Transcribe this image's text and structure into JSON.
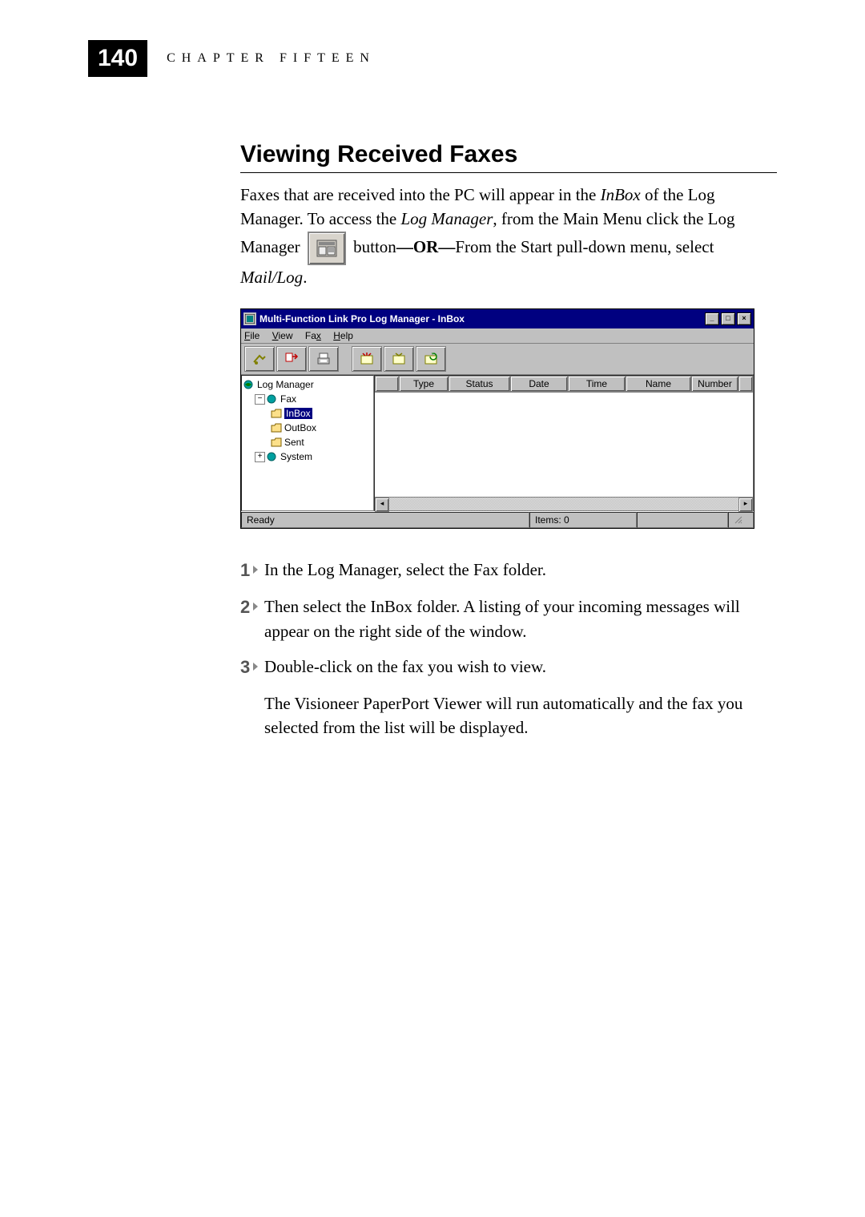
{
  "header": {
    "page_number": "140",
    "chapter_label": "CHAPTER FIFTEEN"
  },
  "section_title": "Viewing Received Faxes",
  "body": {
    "p1a": "Faxes that are received into the PC will appear in the ",
    "p1b": "InBox",
    "p1c": " of the Log Manager.  To access the ",
    "p1d": "Log Manager",
    "p1e": ", from the Main Menu click the Log Manager ",
    "p2a": " button",
    "p2b": "—OR—",
    "p2c": "From the Start pull-down menu, select ",
    "p2d": "Mail/Log",
    "p2e": "."
  },
  "window": {
    "title": "Multi-Function Link Pro Log Manager - InBox",
    "menu": {
      "file": "File",
      "view": "View",
      "fax": "Fax",
      "help": "Help"
    },
    "tree": {
      "root": "Log Manager",
      "fax": "Fax",
      "inbox": "InBox",
      "outbox": "OutBox",
      "sent": "Sent",
      "system": "System"
    },
    "columns": {
      "icon": "",
      "type": "Type",
      "status": "Status",
      "date": "Date",
      "time": "Time",
      "name": "Name",
      "number": "Number"
    },
    "status": {
      "ready": "Ready",
      "items": "Items: 0"
    }
  },
  "steps": {
    "s1a": "In the ",
    "s1b": "Log Manager",
    "s1c": ", select the ",
    "s1d": "Fax",
    "s1e": " folder.",
    "s2a": "Then select the ",
    "s2b": "InBox",
    "s2c": " folder.  A listing of your incoming messages will appear on the right side of the window.",
    "s3": "Double-click on the fax you wish to view.",
    "s3p": "The Visioneer PaperPort Viewer will run automatically and the fax you selected from the list will be displayed."
  },
  "nums": {
    "n1": "1",
    "n2": "2",
    "n3": "3"
  }
}
